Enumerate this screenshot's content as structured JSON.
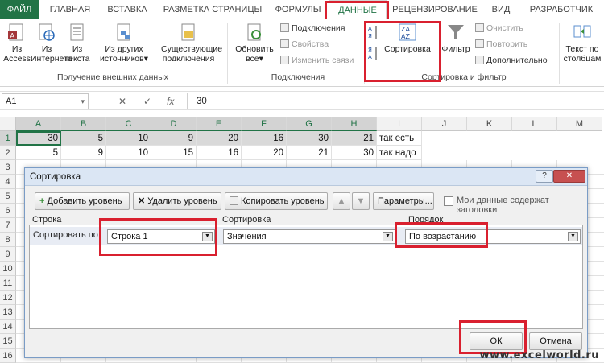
{
  "ribbon_tabs": [
    "ФАЙЛ",
    "ГЛАВНАЯ",
    "ВСТАВКА",
    "РАЗМЕТКА СТРАНИЦЫ",
    "ФОРМУЛЫ",
    "ДАННЫЕ",
    "РЕЦЕНЗИРОВАНИЕ",
    "ВИД",
    "РАЗРАБОТЧИК"
  ],
  "ribbon": {
    "ext_data": {
      "access": "Из Access",
      "internet": "Из Интернета",
      "text": "Из текста",
      "other": "Из других источников",
      "other_arrow": "▾",
      "existing": "Существующие подключения",
      "group": "Получение внешних данных"
    },
    "connections": {
      "refresh": "Обновить все",
      "refresh_arrow": "▾",
      "conns": "Подключения",
      "props": "Свойства",
      "edit_links": "Изменить связи",
      "group": "Подключения"
    },
    "sort_filter": {
      "sort": "Сортировка",
      "filter": "Фильтр",
      "clear": "Очистить",
      "reapply": "Повторить",
      "advanced": "Дополнительно",
      "group": "Сортировка и фильтр"
    },
    "text_to_cols": "Текст по столбцам"
  },
  "formula_bar": {
    "name_box": "A1",
    "name_arrow": "▾",
    "cancel": "✕",
    "enter": "✓",
    "fx": "fx",
    "value": "30"
  },
  "sheet": {
    "columns": [
      "A",
      "B",
      "C",
      "D",
      "E",
      "F",
      "G",
      "H",
      "I",
      "J",
      "K",
      "L",
      "M"
    ],
    "rows": [
      "1",
      "2",
      "3",
      "4",
      "5",
      "6",
      "7",
      "8",
      "9",
      "10",
      "11",
      "12",
      "13",
      "14",
      "15",
      "16"
    ],
    "row1": [
      "30",
      "5",
      "10",
      "9",
      "20",
      "16",
      "30",
      "21",
      "так есть"
    ],
    "row2": [
      "5",
      "9",
      "10",
      "15",
      "16",
      "20",
      "21",
      "30",
      "так надо"
    ]
  },
  "dialog": {
    "title": "Сортировка",
    "help": "?",
    "close": "✕",
    "add_level": "Добавить уровень",
    "delete_level": "Удалить уровень",
    "copy_level": "Копировать уровень",
    "up": "▲",
    "down": "▼",
    "params": "Параметры...",
    "headers_checkbox": "Мои данные содержат заголовки",
    "col_row": "Строка",
    "col_sort": "Сортировка",
    "col_order": "Порядок",
    "sort_by": "Сортировать по",
    "row_value": "Строка 1",
    "sort_value": "Значения",
    "order_value": "По возрастанию",
    "combo_arrow": "▼",
    "ok": "ОК",
    "cancel": "Отмена"
  },
  "watermark": "www.excelworld.ru"
}
